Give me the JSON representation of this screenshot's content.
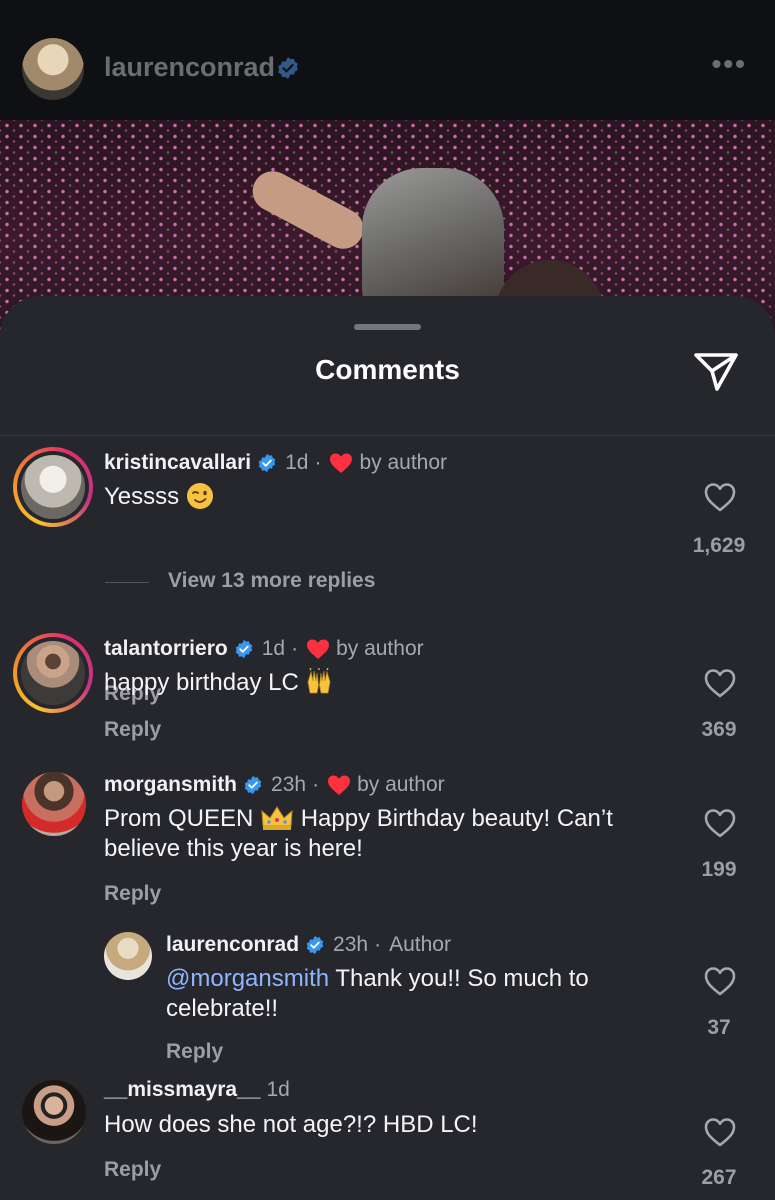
{
  "post": {
    "username": "laurenconrad",
    "more_label": "•••"
  },
  "sheet": {
    "title": "Comments"
  },
  "comments": [
    {
      "username": "kristincavallari",
      "time": "1d",
      "badge": "by author",
      "text": "Yessss",
      "reply_label": "Reply",
      "likes": "1,629",
      "view_replies": "View 13 more replies"
    },
    {
      "username": "talantorriero",
      "time": "1d",
      "badge": "by author",
      "text": "happy birthday LC",
      "reply_label": "Reply",
      "likes": "369"
    },
    {
      "username": "morgansmith",
      "time": "23h",
      "badge": "by author",
      "text_line1": "Prom QUEEN",
      "text_line1b": "Happy Birthday beauty! Can’t",
      "text_line2": "believe this year is here!",
      "reply_label": "Reply",
      "likes": "199"
    },
    {
      "username": "laurenconrad",
      "time": "23h",
      "badge": "Author",
      "mention": "@morgansmith",
      "text_line1": "Thank you!! So much to",
      "text_line2": "celebrate!!",
      "reply_label": "Reply",
      "likes": "37"
    },
    {
      "username": "__missmayra__",
      "time": "1d",
      "text": "How does she not age?!? HBD LC!",
      "reply_label": "Reply",
      "likes": "267"
    }
  ],
  "colors": {
    "sheet_bg": "#26272c",
    "verified": "#3897f0",
    "heart": "#ff3040",
    "mention": "#8eb6ff"
  },
  "icons": [
    "verified-badge-icon",
    "more-icon",
    "share-icon",
    "heart-icon",
    "like-icon",
    "wink-emoji-icon",
    "raised-hands-emoji-icon",
    "crown-emoji-icon"
  ]
}
